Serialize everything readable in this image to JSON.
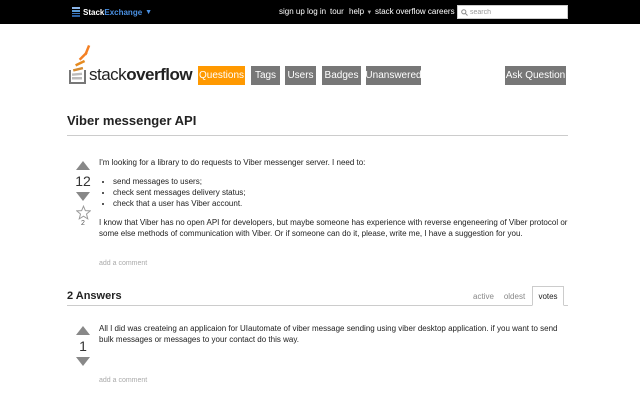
{
  "topbar": {
    "brand_prefix": "Stack",
    "brand_suffix": "Exchange",
    "brand_caret": "▼",
    "links": [
      "sign up",
      "log in",
      "tour",
      "help",
      "stack overflow careers"
    ],
    "help_caret": "▼",
    "search_placeholder": "search"
  },
  "header": {
    "logo_light": "stack",
    "logo_bold": "overflow",
    "nav": [
      "Questions",
      "Tags",
      "Users",
      "Badges",
      "Unanswered"
    ],
    "ask_button": "Ask Question"
  },
  "question": {
    "title": "Viber messenger API",
    "votes": "12",
    "favorites": "2",
    "intro": "I'm looking for a library to do requests to Viber messenger server. I need to:",
    "bullets": [
      "send messages to users;",
      "check sent messages delivery status;",
      "check that a user has Viber account."
    ],
    "body": "I know that Viber has no open API for developers, but maybe someone has experience with reverse engeneering of Viber protocol or some else methods of communication with Viber. Or if someone can do it, please, write me, I have a suggestion for you.",
    "add_comment": "add a comment"
  },
  "answers": {
    "heading": "2 Answers",
    "tabs": [
      "active",
      "oldest",
      "votes"
    ],
    "active_tab": "votes",
    "first": {
      "votes": "1",
      "body": "All I did was createing an applicaion for UIautomate of viber message sending using viber desktop application. if you want to send bulk messages or messages to your contact do this way.",
      "add_comment": "add a comment"
    }
  },
  "colors": {
    "topbar": "#000000",
    "nav_active": "#ff9900",
    "nav_default": "#777777",
    "brand_blue": "#4a90e2"
  }
}
